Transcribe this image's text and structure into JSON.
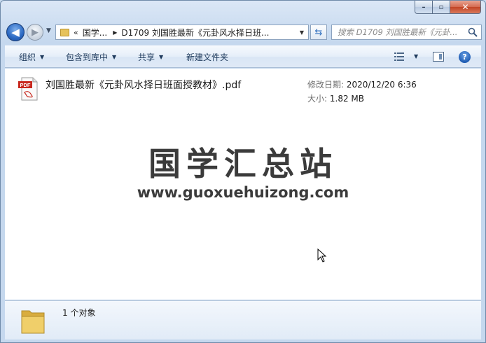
{
  "window": {
    "caption": {
      "minimize_glyph": "–",
      "maximize_glyph": "▫",
      "close_glyph": "✕"
    }
  },
  "navbar": {
    "back_glyph": "◀",
    "forward_glyph": "▶",
    "address": {
      "overflow": "«",
      "crumbs": [
        "国学...",
        "D1709 刘国胜最新《元卦风水择日班..."
      ],
      "arrow": "▶"
    },
    "search": {
      "placeholder": "搜索 D1709 刘国胜最新《元卦..."
    }
  },
  "toolbar": {
    "organize": "组织",
    "include_in_library": "包含到库中",
    "share": "共享",
    "new_folder": "新建文件夹",
    "help": "?"
  },
  "file": {
    "name": "刘国胜最新《元卦风水择日班面授教材》.pdf",
    "icon_label": "PDF",
    "modified_label": "修改日期:",
    "modified_value": "2020/12/20 6:36",
    "size_label": "大小:",
    "size_value": "1.82 MB"
  },
  "watermark": {
    "title": "国学汇总站",
    "url": "www.guoxuehuizong.com"
  },
  "details": {
    "count": "1 个对象"
  },
  "colors": {
    "accent": "#2a68c2",
    "pdf_red": "#c8281e",
    "folder": "#e6c25c"
  }
}
